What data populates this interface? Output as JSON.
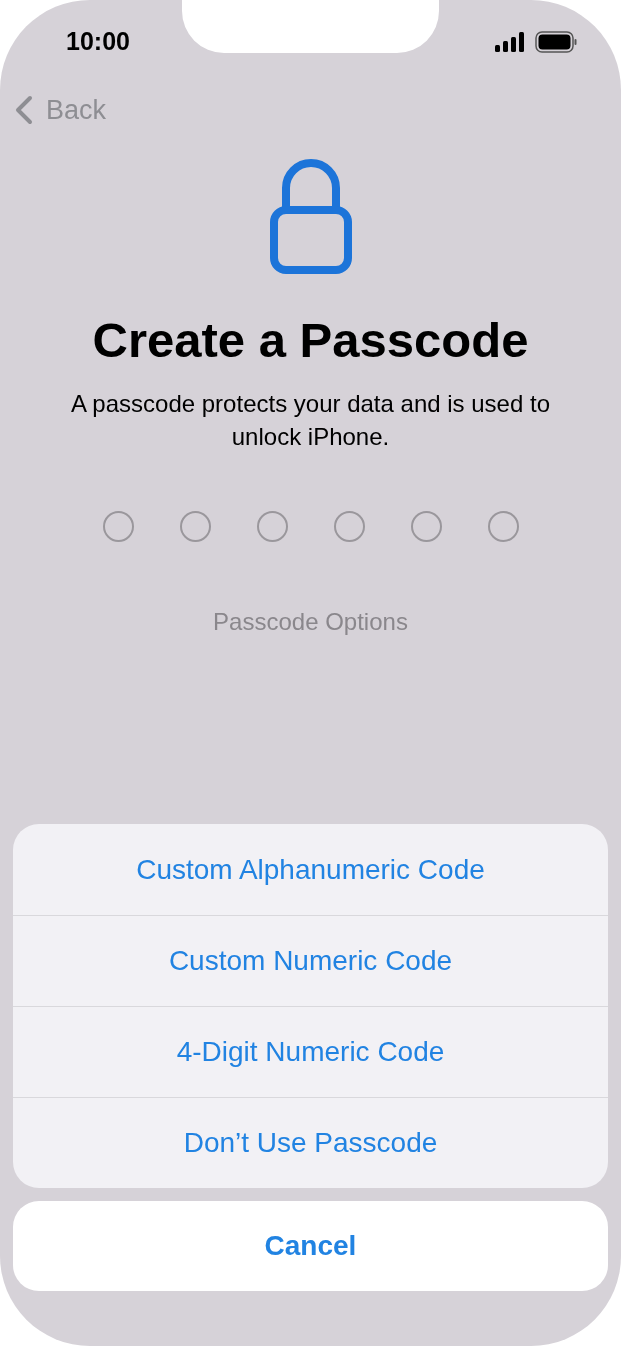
{
  "status_bar": {
    "time": "10:00"
  },
  "nav": {
    "back": "Back"
  },
  "title": "Create a Passcode",
  "subtitle": "A passcode protects your data and is used to unlock iPhone.",
  "passcode_dots": [
    {
      "filled": false
    },
    {
      "filled": false
    },
    {
      "filled": false
    },
    {
      "filled": false
    },
    {
      "filled": false
    },
    {
      "filled": false
    }
  ],
  "options_link": "Passcode Options",
  "action_sheet": {
    "options": [
      "Custom Alphanumeric Code",
      "Custom Numeric Code",
      "4-Digit Numeric Code",
      "Don’t Use Passcode"
    ],
    "cancel": "Cancel"
  }
}
